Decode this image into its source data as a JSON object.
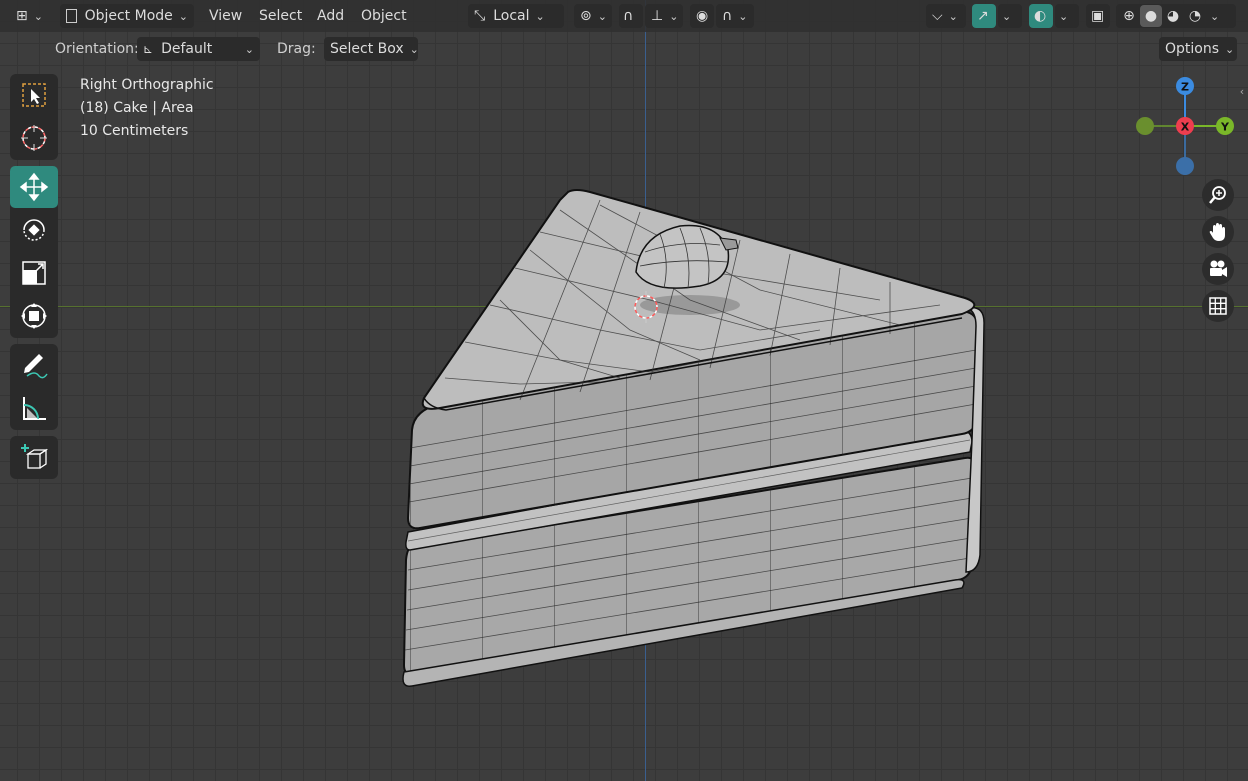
{
  "header": {
    "mode_label": "Object Mode",
    "menus": [
      "View",
      "Select",
      "Add",
      "Object"
    ],
    "transform_orientation": "Local"
  },
  "tool_settings": {
    "orientation_label": "Orientation:",
    "orientation_value": "Default",
    "drag_label": "Drag:",
    "drag_value": "Select Box",
    "options_label": "Options"
  },
  "viewport_info": {
    "view_name": "Right Orthographic",
    "object_info": "(18) Cake | Area",
    "scale": "10 Centimeters"
  },
  "gizmo": {
    "z": "Z",
    "x": "X",
    "y": "Y"
  },
  "toolbar": {
    "active_tool": "move",
    "tools": [
      "select-box",
      "cursor",
      "move",
      "rotate",
      "scale",
      "transform",
      "annotate",
      "measure",
      "add-cube"
    ]
  },
  "navigation": [
    "zoom",
    "pan",
    "camera",
    "grid"
  ],
  "colors": {
    "accent": "#2f8a7e",
    "axis_x": "#ee3e4f",
    "axis_y": "#7ab729",
    "axis_z": "#3b8be0",
    "background": "#3d3d3d"
  }
}
